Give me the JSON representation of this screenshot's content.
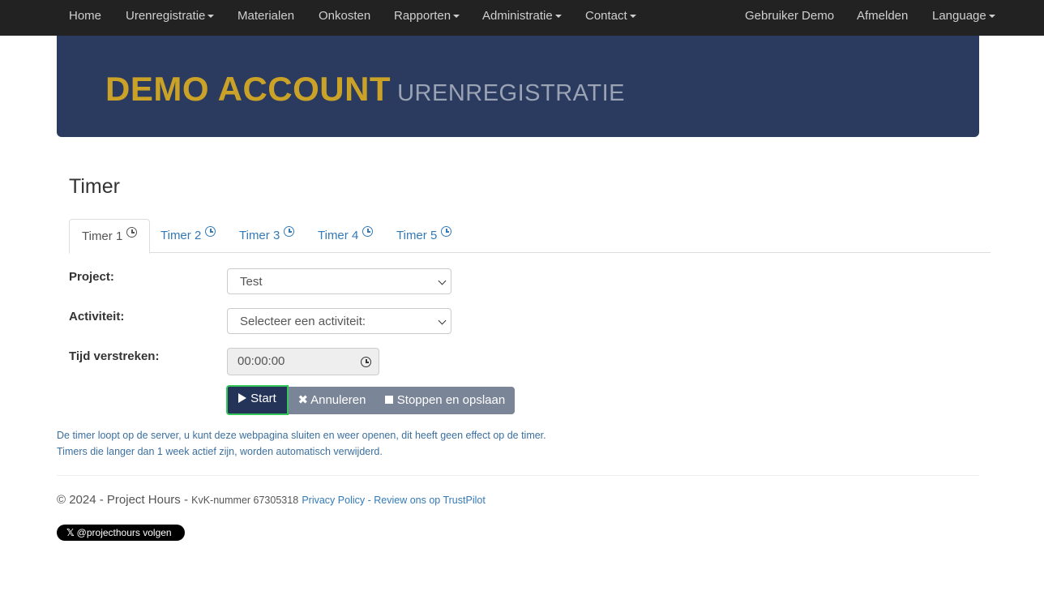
{
  "nav": {
    "left": [
      "Home",
      "Urenregistratie",
      "Materialen",
      "Onkosten",
      "Rapporten",
      "Administratie",
      "Contact"
    ],
    "right": [
      "Gebruiker Demo",
      "Afmelden",
      "Language"
    ]
  },
  "banner": {
    "title": "DEMO ACCOUNT",
    "subtitle": "URENREGISTRATIE"
  },
  "page": {
    "title": "Timer"
  },
  "tabs": [
    "Timer 1",
    "Timer 2",
    "Timer 3",
    "Timer 4",
    "Timer 5"
  ],
  "form": {
    "project_label": "Project:",
    "project_value": "Test",
    "activity_label": "Activiteit:",
    "activity_value": "Selecteer een activiteit:",
    "elapsed_label": "Tijd verstreken:",
    "elapsed_value": "00:00:00"
  },
  "buttons": {
    "start": "Start",
    "cancel": "Annuleren",
    "stop": "Stoppen en opslaan"
  },
  "notes": [
    "De timer loopt op de server, u kunt deze webpagina sluiten en weer openen, dit heeft geen effect op de timer.",
    "Timers die langer dan 1 week actief zijn, worden automatisch verwijderd."
  ],
  "footer": {
    "copyright": "© 2024 - Project Hours - ",
    "kvk": "KvK-nummer 67305318",
    "privacy": "Privacy Policy",
    "separator": " - ",
    "review": "Review ons op TrustPilot",
    "follow": "@projecthours volgen"
  },
  "colors": {
    "navbar": "#222222",
    "banner": "#2b3a5f",
    "brand": "#c9a227",
    "start_outline": "#35c759",
    "link": "#337ab7"
  }
}
